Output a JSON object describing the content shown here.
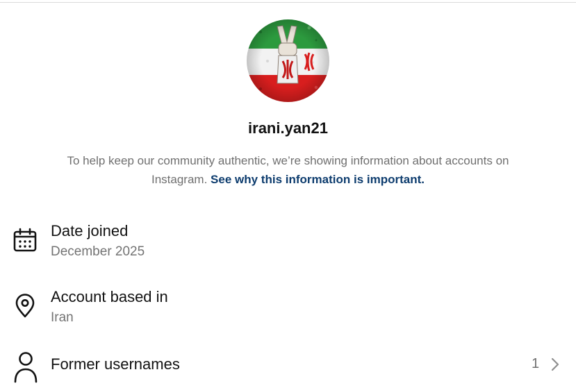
{
  "profile": {
    "username": "irani.yan21",
    "avatar_icon": "iran-flag-victory-hand-avatar"
  },
  "notice": {
    "text": "To help keep our community authentic, we’re showing information about accounts on Instagram.",
    "link": "See why this information is important."
  },
  "details": {
    "date_joined": {
      "icon": "calendar-icon",
      "title": "Date joined",
      "value": "December 2025"
    },
    "account_based_in": {
      "icon": "location-pin-icon",
      "title": "Account based in",
      "value": "Iran"
    },
    "former_usernames": {
      "icon": "person-icon",
      "title": "Former usernames",
      "count": "1"
    }
  },
  "colors": {
    "link": "#0d3c6e",
    "muted_text": "#6f6f6f",
    "flag_green": "#239f40",
    "flag_red": "#da0000"
  }
}
